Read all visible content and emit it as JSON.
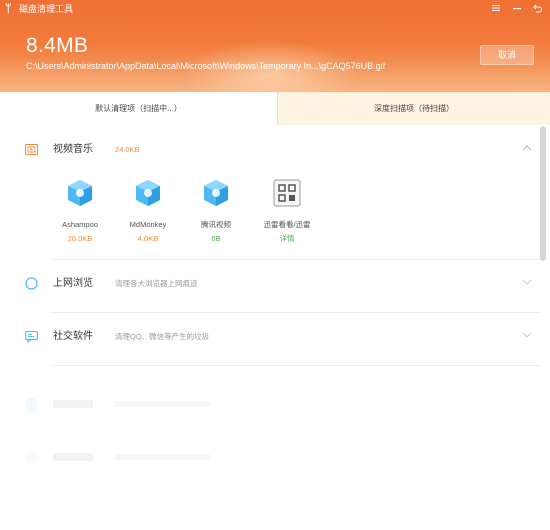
{
  "app": {
    "title": "磁盘清理工具",
    "logo_icon": "broom-icon"
  },
  "window_controls": {
    "menu_icon": "menu-icon",
    "minimize_icon": "minimize-icon",
    "back_icon": "back-icon"
  },
  "scan": {
    "size": "8.4MB",
    "path": "C:\\Users\\Administrator\\AppData\\Local\\Microsoft\\Windows\\Temporary In...\\gCAQ576UB.gif",
    "cancel_label": "取消"
  },
  "tabs": [
    {
      "label": "默认清理项（扫描中...）",
      "active": true
    },
    {
      "label": "深度扫描项（待扫描）",
      "active": false
    }
  ],
  "sections": [
    {
      "title": "视频音乐",
      "size": "24.0KB",
      "icon": "media-icon",
      "expanded": true,
      "chevron": "chevron-up-icon",
      "items": [
        {
          "name": "Ashampoo",
          "value": "20.0KB",
          "value_color": "#f08a3a",
          "icon": "cube-icon"
        },
        {
          "name": "MdMonkey",
          "value": "4.0KB",
          "value_color": "#f08a3a",
          "icon": "cube-icon"
        },
        {
          "name": "腾讯视频",
          "value": "0B",
          "value_color": "#4caf50",
          "icon": "cube-icon"
        },
        {
          "name": "迅雷看看/迅雷",
          "value": "详情",
          "value_color": "#4caf50",
          "icon": "qr-grid-icon"
        }
      ]
    },
    {
      "title": "上网浏览",
      "desc": "清理各大浏览器上网痕迹",
      "icon": "globe-icon",
      "expanded": false,
      "chevron": "chevron-down-icon"
    },
    {
      "title": "社交软件",
      "desc": "清理QQ、微信等产生的垃圾",
      "icon": "chat-icon",
      "expanded": false,
      "chevron": "chevron-down-icon"
    }
  ],
  "colors": {
    "header_top": "#f06f34",
    "header_bottom": "#f5a467",
    "accent_orange": "#f08a3a",
    "accent_green": "#4caf50",
    "icon_blue": "#4fb8f0",
    "inactive_tab_bg": "#fef3e1"
  }
}
